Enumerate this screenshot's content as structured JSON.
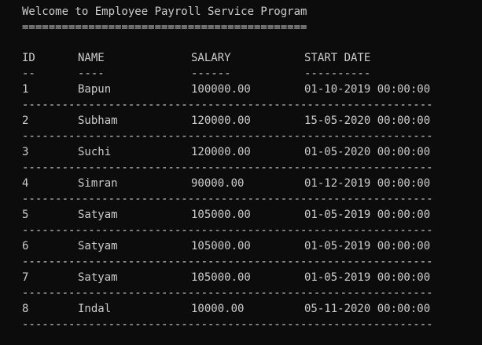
{
  "console": {
    "title": "Welcome to Employee Payroll Service Program",
    "title_underline": "===========================================",
    "headers": {
      "id": "ID",
      "name": "NAME",
      "salary": "SALARY",
      "start_date": "START DATE"
    },
    "header_underlines": {
      "id": "--",
      "name": "----",
      "salary": "------",
      "start_date": "----------"
    },
    "row_separator": "--------------------------------------------------------------",
    "rows": [
      {
        "id": "1",
        "name": "Bapun",
        "salary": "100000.00",
        "start_date": "01-10-2019 00:00:00"
      },
      {
        "id": "2",
        "name": "Subham",
        "salary": "120000.00",
        "start_date": "15-05-2020 00:00:00"
      },
      {
        "id": "3",
        "name": "Suchi",
        "salary": "120000.00",
        "start_date": "01-05-2020 00:00:00"
      },
      {
        "id": "4",
        "name": "Simran",
        "salary": "90000.00",
        "start_date": "01-12-2019 00:00:00"
      },
      {
        "id": "5",
        "name": "Satyam",
        "salary": "105000.00",
        "start_date": "01-05-2019 00:00:00"
      },
      {
        "id": "6",
        "name": "Satyam",
        "salary": "105000.00",
        "start_date": "01-05-2019 00:00:00"
      },
      {
        "id": "7",
        "name": "Satyam",
        "salary": "105000.00",
        "start_date": "01-05-2019 00:00:00"
      },
      {
        "id": "8",
        "name": "Indal",
        "salary": "10000.00",
        "start_date": "05-11-2020 00:00:00"
      }
    ]
  },
  "colors": {
    "background": "#0c0c0c",
    "text": "#cccccc"
  }
}
